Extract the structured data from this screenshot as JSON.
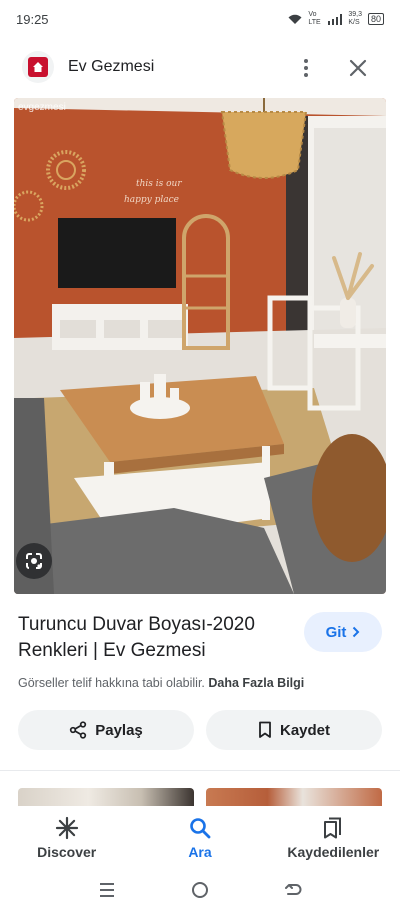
{
  "status_bar": {
    "time": "19:25",
    "network_label": "Vo LTE",
    "speed_value": "39,3",
    "speed_unit": "K/S",
    "battery": "80"
  },
  "header": {
    "site_name": "Ev Gezmesi",
    "logo_color": "#c8102e"
  },
  "image": {
    "watermark": "evgezmesi",
    "wall_text_line1": "this is our",
    "wall_text_line2": "happy place"
  },
  "result": {
    "title": "Turuncu Duvar Boyası-2020 Renkleri | Ev Gezmesi",
    "visit_label": "Git",
    "copyright_text": "Görseller telif hakkına tabi olabilir.",
    "more_info_label": "Daha Fazla Bilgi"
  },
  "actions": {
    "share_label": "Paylaş",
    "save_label": "Kaydet"
  },
  "bottom_nav": {
    "items": [
      {
        "label": "Discover",
        "icon": "asterisk-icon"
      },
      {
        "label": "Ara",
        "icon": "search-icon"
      },
      {
        "label": "Kaydedilenler",
        "icon": "bookmarks-icon"
      }
    ],
    "active_index": 1
  },
  "colors": {
    "accent": "#1a73e8",
    "accent_bg": "#e8f0fe",
    "wall": "#b9532d"
  }
}
